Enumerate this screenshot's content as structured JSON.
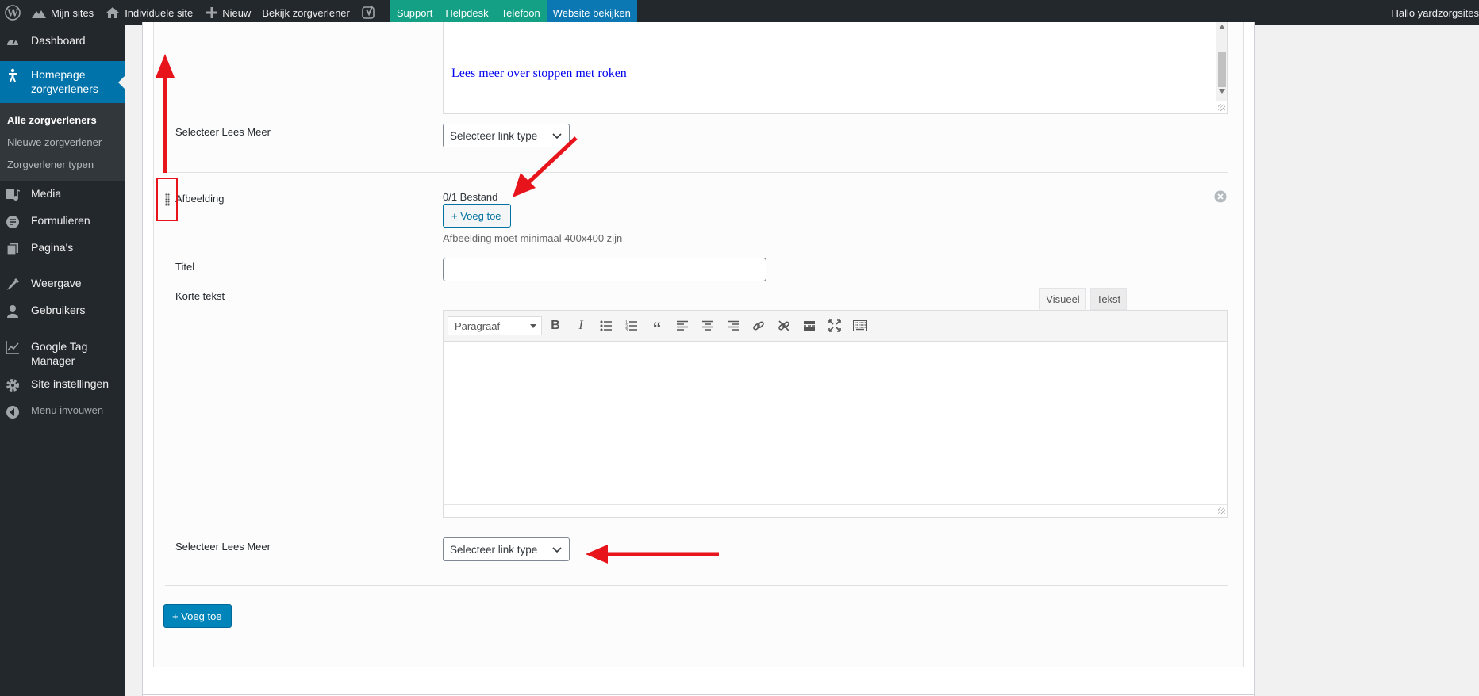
{
  "adminbar": {
    "items": [
      {
        "label": "",
        "icon": "wordpress-icon"
      },
      {
        "label": "Mijn sites",
        "icon": "sites-icon"
      },
      {
        "label": "Individuele site",
        "icon": "home-icon"
      },
      {
        "label": "Nieuw",
        "icon": "plus-icon"
      },
      {
        "label": "Bekijk zorgverlener",
        "icon": ""
      },
      {
        "label": "",
        "icon": "yoast-icon"
      },
      {
        "label": "Support",
        "style": "green"
      },
      {
        "label": "Helpdesk",
        "style": "green"
      },
      {
        "label": "Telefoon",
        "style": "green"
      },
      {
        "label": "Website bekijken",
        "style": "blue"
      }
    ],
    "greeting": "Hallo yardzorgsites"
  },
  "sidebar": {
    "items": [
      {
        "label": "Dashboard",
        "icon": "dashboard-icon"
      },
      {
        "label": "Homepage zorgverleners",
        "icon": "pin-icon",
        "current": true
      },
      {
        "label": "Media",
        "icon": "media-icon"
      },
      {
        "label": "Formulieren",
        "icon": "forms-icon"
      },
      {
        "label": "Pagina's",
        "icon": "pages-icon"
      },
      {
        "label": "Weergave",
        "icon": "appearance-icon"
      },
      {
        "label": "Gebruikers",
        "icon": "users-icon"
      },
      {
        "label": "Google Tag Manager",
        "icon": "chart-icon"
      },
      {
        "label": "Site instellingen",
        "icon": "settings-icon"
      },
      {
        "label": "Menu invouwen",
        "icon": "collapse-icon"
      }
    ],
    "submenu": [
      "Alle zorgverleners",
      "Nieuwe zorgverlener",
      "Zorgverlener typen"
    ]
  },
  "main": {
    "editor_link": "Lees meer over stoppen met roken",
    "lees_meer_label_1": "Selecteer Lees Meer",
    "link_type_select_1": "Selecteer link type",
    "afbeelding_label": "Afbeelding",
    "file_count": "0/1 Bestand",
    "add_button": "+ Voeg toe",
    "image_hint": "Afbeelding moet minimaal 400x400 zijn",
    "titel_label": "Titel",
    "titel_value": "",
    "korte_tekst_label": "Korte tekst",
    "tab_visual": "Visueel",
    "tab_text": "Tekst",
    "format_select": "Paragraaf",
    "toolbar_buttons": [
      "bold-icon",
      "italic-icon",
      "bullet-list-icon",
      "numbered-list-icon",
      "blockquote-icon",
      "align-left-icon",
      "align-center-icon",
      "align-right-icon",
      "link-icon",
      "unlink-icon",
      "read-more-icon",
      "fullscreen-icon",
      "keyboard-icon"
    ],
    "lees_meer_label_2": "Selecteer Lees Meer",
    "link_type_select_2": "Selecteer link type",
    "add_row_button": "+ Voeg toe"
  },
  "colors": {
    "adminbar": "#23282d",
    "accent": "#0073aa",
    "green": "#14a085",
    "annotation": "#e8141c"
  }
}
